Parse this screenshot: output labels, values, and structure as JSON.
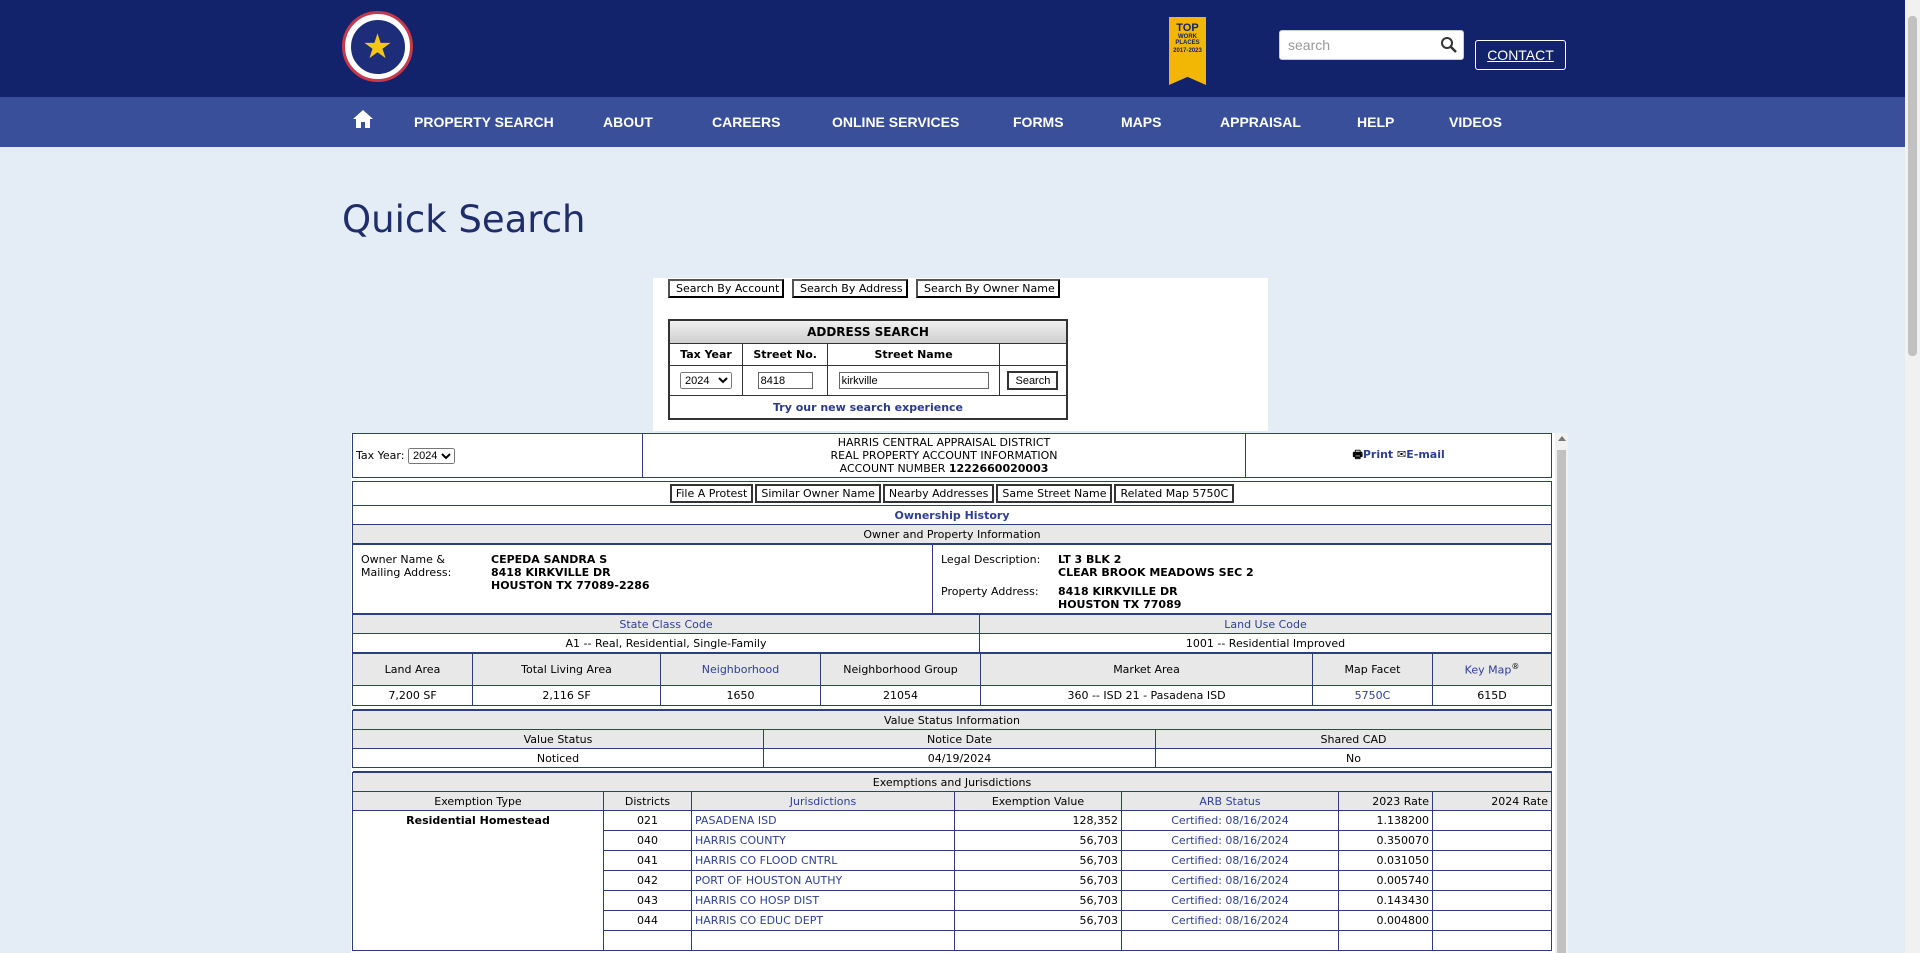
{
  "header": {
    "badge_line1": "TOP",
    "badge_line2": "WORK PLACES",
    "badge_line3": "2017-2023",
    "search_placeholder": "search",
    "contact_label": "CONTACT"
  },
  "nav": {
    "items": [
      {
        "label": "PROPERTY SEARCH"
      },
      {
        "label": "ABOUT"
      },
      {
        "label": "CAREERS"
      },
      {
        "label": "ONLINE SERVICES"
      },
      {
        "label": "FORMS"
      },
      {
        "label": "MAPS"
      },
      {
        "label": "APPRAISAL"
      },
      {
        "label": "HELP"
      },
      {
        "label": "VIDEOS"
      }
    ]
  },
  "page_title": "Quick Search",
  "search_tabs": [
    "Search By Account",
    "Search By Address",
    "Search By Owner Name"
  ],
  "address_search": {
    "title": "ADDRESS SEARCH",
    "col_tax_year": "Tax Year",
    "col_street_no": "Street No.",
    "col_street_name": "Street Name",
    "tax_year": "2024",
    "street_no": "8418",
    "street_name": "kirkville",
    "search_button": "Search",
    "new_search_link": "Try our new search experience"
  },
  "account": {
    "tax_year_label": "Tax Year:",
    "tax_year": "2024",
    "line1": "HARRIS CENTRAL APPRAISAL DISTRICT",
    "line2": "REAL PROPERTY ACCOUNT INFORMATION",
    "account_label": "ACCOUNT NUMBER",
    "account_number": "1222660020003",
    "print_label": "Print",
    "email_label": "E-mail"
  },
  "action_buttons": [
    "File A Protest",
    "Similar Owner Name",
    "Nearby Addresses",
    "Same Street Name",
    "Related Map 5750C"
  ],
  "ownership_history_link": "Ownership History",
  "owner_section": {
    "title": "Owner and Property Information",
    "owner_label_1": "Owner Name &",
    "owner_label_2": "Mailing Address:",
    "owner_name": "CEPEDA SANDRA S",
    "mail_line1": "8418 KIRKVILLE DR",
    "mail_line2": "HOUSTON TX 77089-2286",
    "legal_label": "Legal Description:",
    "legal_line1": "LT 3 BLK 2",
    "legal_line2": "CLEAR BROOK MEADOWS SEC 2",
    "prop_label": "Property Address:",
    "prop_line1": "8418 KIRKVILLE DR",
    "prop_line2": "HOUSTON TX 77089"
  },
  "classification": {
    "state_class_label": "State Class Code",
    "state_class_value": "A1 -- Real, Residential, Single-Family",
    "land_use_label": "Land Use Code",
    "land_use_value": "1001 -- Residential Improved"
  },
  "land_table": {
    "headers": {
      "land_area": "Land Area",
      "living_area": "Total Living Area",
      "neighborhood": "Neighborhood",
      "neighborhood_group": "Neighborhood Group",
      "market_area": "Market Area",
      "map_facet": "Map Facet",
      "key_map": "Key Map",
      "key_map_sup": "®"
    },
    "values": {
      "land_area": "7,200 SF",
      "living_area": "2,116 SF",
      "neighborhood": "1650",
      "neighborhood_group": "21054",
      "market_area": "360 -- ISD 21 - Pasadena ISD",
      "map_facet": "5750C",
      "key_map": "615D"
    }
  },
  "value_status": {
    "title": "Value Status Information",
    "h_status": "Value Status",
    "h_notice": "Notice Date",
    "h_shared": "Shared CAD",
    "status": "Noticed",
    "notice_date": "04/19/2024",
    "shared_cad": "No"
  },
  "exemptions": {
    "title": "Exemptions and Jurisdictions",
    "h_type": "Exemption Type",
    "h_districts": "Districts",
    "h_jurisdictions": "Jurisdictions",
    "h_value": "Exemption Value",
    "h_arb": "ARB Status",
    "h_rate2023": "2023 Rate",
    "h_rate2024": "2024 Rate",
    "exemption_type": "Residential Homestead",
    "rows": [
      {
        "district": "021",
        "jurisdiction": "PASADENA ISD",
        "value": "128,352",
        "arb": "Certified: 08/16/2024",
        "rate2023": "1.138200",
        "rate2024": ""
      },
      {
        "district": "040",
        "jurisdiction": "HARRIS COUNTY",
        "value": "56,703",
        "arb": "Certified: 08/16/2024",
        "rate2023": "0.350070",
        "rate2024": ""
      },
      {
        "district": "041",
        "jurisdiction": "HARRIS CO FLOOD CNTRL",
        "value": "56,703",
        "arb": "Certified: 08/16/2024",
        "rate2023": "0.031050",
        "rate2024": ""
      },
      {
        "district": "042",
        "jurisdiction": "PORT OF HOUSTON AUTHY",
        "value": "56,703",
        "arb": "Certified: 08/16/2024",
        "rate2023": "0.005740",
        "rate2024": ""
      },
      {
        "district": "043",
        "jurisdiction": "HARRIS CO HOSP DIST",
        "value": "56,703",
        "arb": "Certified: 08/16/2024",
        "rate2023": "0.143430",
        "rate2024": ""
      },
      {
        "district": "044",
        "jurisdiction": "HARRIS CO EDUC DEPT",
        "value": "56,703",
        "arb": "Certified: 08/16/2024",
        "rate2023": "0.004800",
        "rate2024": ""
      }
    ]
  }
}
